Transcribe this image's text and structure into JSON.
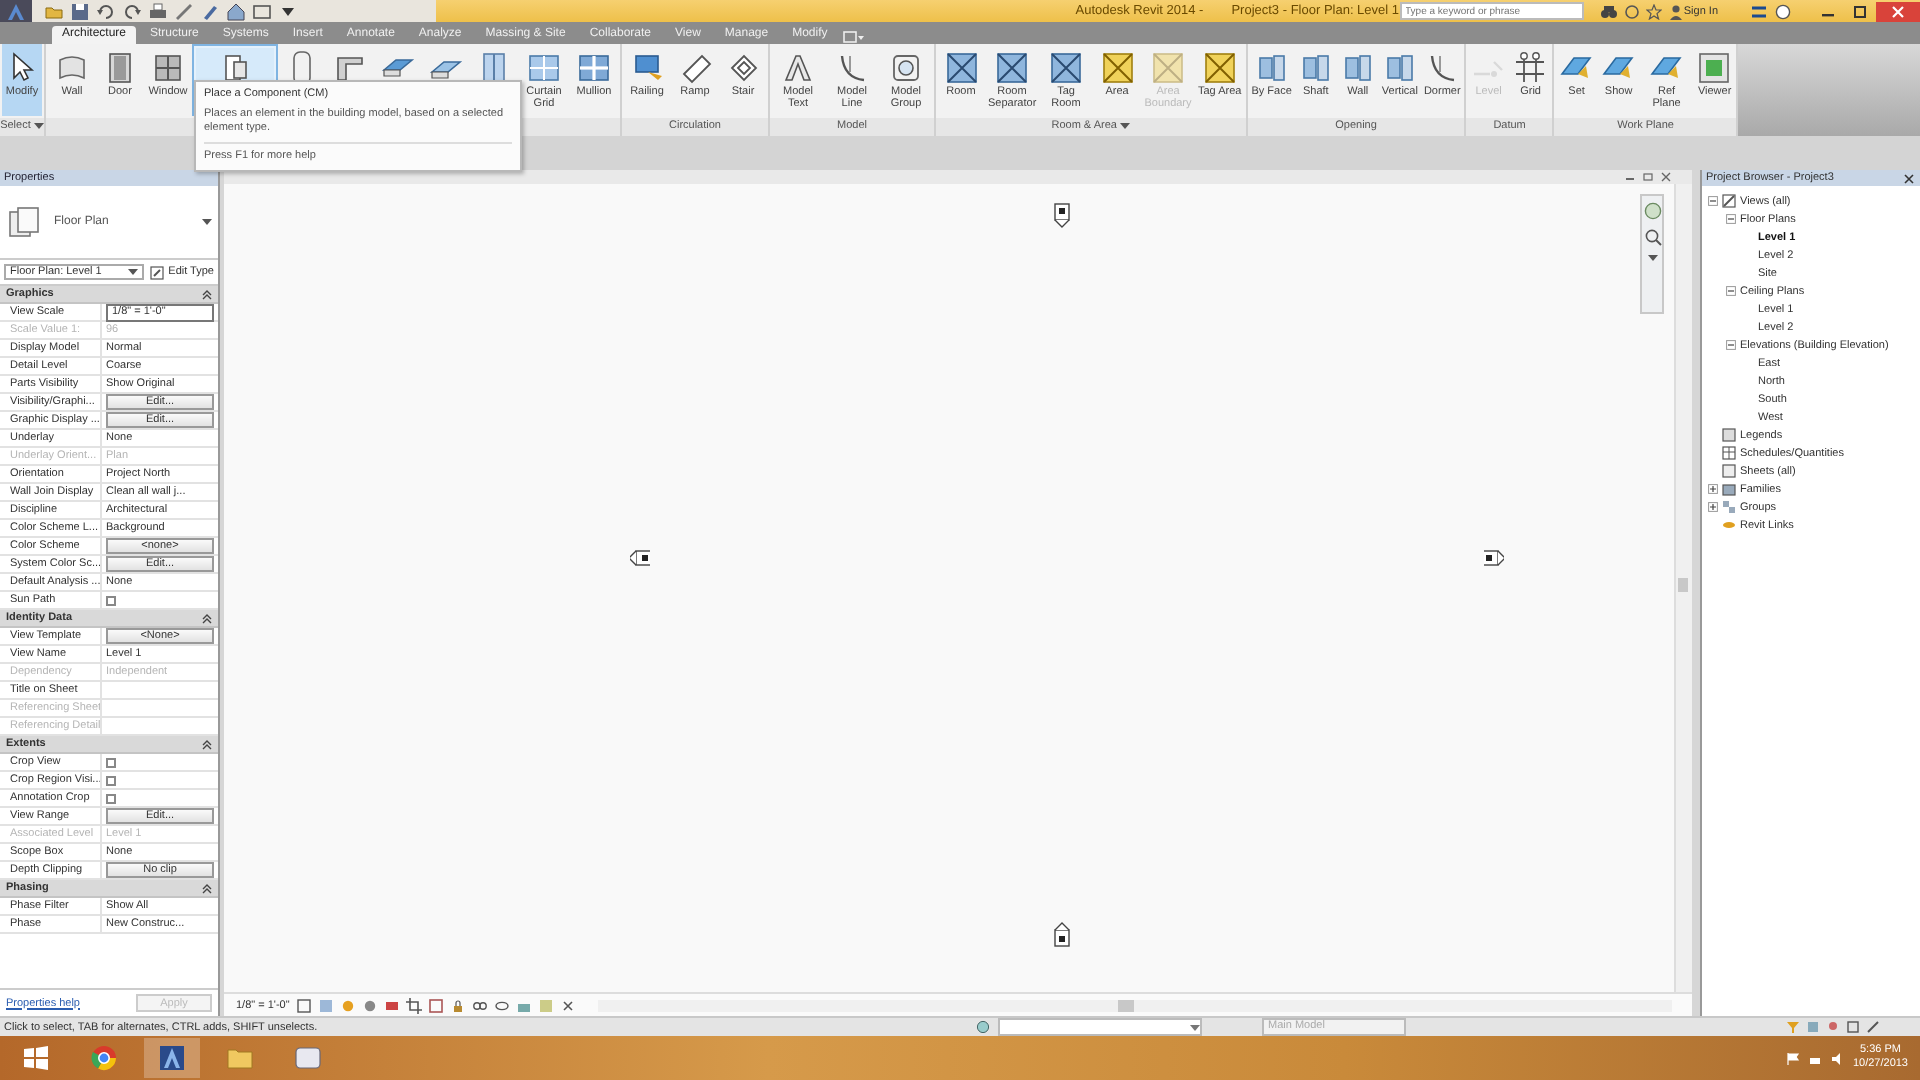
{
  "title_bar": {
    "app_title": "Autodesk Revit 2014 -",
    "document_title": "Project3 - Floor Plan: Level 1",
    "search": {
      "placeholder": "Type a keyword or phrase"
    },
    "sign_in": "Sign In"
  },
  "ribbon_tabs": [
    {
      "label": "Architecture",
      "selected": true
    },
    {
      "label": "Structure",
      "selected": false
    },
    {
      "label": "Systems",
      "selected": false
    },
    {
      "label": "Insert",
      "selected": false
    },
    {
      "label": "Annotate",
      "selected": false
    },
    {
      "label": "Analyze",
      "selected": false
    },
    {
      "label": "Massing & Site",
      "selected": false
    },
    {
      "label": "Collaborate",
      "selected": false
    },
    {
      "label": "View",
      "selected": false
    },
    {
      "label": "Manage",
      "selected": false
    },
    {
      "label": "Modify",
      "selected": false
    }
  ],
  "ribbon_panels": [
    {
      "label": "Select",
      "dropdown": true,
      "buttons": [
        {
          "label": "Modify",
          "active": true,
          "highlighted": false,
          "disabled": false
        }
      ]
    },
    {
      "buttons": [
        {
          "label": "Wall",
          "active": false,
          "highlighted": false,
          "disabled": false
        },
        {
          "label": "Door",
          "active": false,
          "highlighted": false,
          "disabled": false
        },
        {
          "label": "Window",
          "active": false,
          "highlighted": false,
          "disabled": false
        },
        {
          "active": false,
          "highlighted": true,
          "disabled": false
        },
        {
          "active": false,
          "highlighted": false,
          "disabled": false
        },
        {
          "active": false,
          "highlighted": false,
          "disabled": false
        },
        {
          "active": false,
          "highlighted": false,
          "disabled": false
        },
        {
          "active": false,
          "highlighted": false,
          "disabled": false
        },
        {
          "active": false,
          "highlighted": false,
          "disabled": false
        },
        {
          "label": "Curtain Grid",
          "active": false,
          "highlighted": false,
          "disabled": false
        },
        {
          "label": "Mullion",
          "active": false,
          "highlighted": false,
          "disabled": false
        }
      ]
    },
    {
      "label": "Circulation",
      "dropdown": false,
      "buttons": [
        {
          "label": "Railing",
          "active": false,
          "highlighted": false,
          "disabled": false
        },
        {
          "label": "Ramp",
          "active": false,
          "highlighted": false,
          "disabled": false
        },
        {
          "label": "Stair",
          "active": false,
          "highlighted": false,
          "disabled": false
        }
      ]
    },
    {
      "label": "Model",
      "dropdown": false,
      "buttons": [
        {
          "label": "Model Text",
          "active": false,
          "highlighted": false,
          "disabled": false
        },
        {
          "label": "Model Line",
          "active": false,
          "highlighted": false,
          "disabled": false
        },
        {
          "label": "Model Group",
          "active": false,
          "highlighted": false,
          "disabled": false
        }
      ]
    },
    {
      "label": "Room & Area",
      "dropdown": true,
      "buttons": [
        {
          "label": "Room",
          "active": false,
          "highlighted": false,
          "disabled": false
        },
        {
          "label": "Room Separator",
          "active": false,
          "highlighted": false,
          "disabled": false
        },
        {
          "label": "Tag Room",
          "active": false,
          "highlighted": false,
          "disabled": false
        },
        {
          "label": "Area",
          "active": false,
          "highlighted": false,
          "disabled": false
        },
        {
          "label": "Area Boundary",
          "active": false,
          "highlighted": false,
          "disabled": true
        },
        {
          "label": "Tag Area",
          "active": false,
          "highlighted": false,
          "disabled": false
        }
      ]
    },
    {
      "label": "Opening",
      "dropdown": false,
      "buttons": [
        {
          "label": "By Face",
          "active": false,
          "highlighted": false,
          "disabled": false
        },
        {
          "label": "Shaft",
          "active": false,
          "highlighted": false,
          "disabled": false
        },
        {
          "label": "Wall",
          "active": false,
          "highlighted": false,
          "disabled": false
        },
        {
          "label": "Vertical",
          "active": false,
          "highlighted": false,
          "disabled": false
        },
        {
          "label": "Dormer",
          "active": false,
          "highlighted": false,
          "disabled": false
        }
      ]
    },
    {
      "label": "Datum",
      "dropdown": false,
      "buttons": [
        {
          "label": "Level",
          "active": false,
          "highlighted": false,
          "disabled": true
        },
        {
          "label": "Grid",
          "active": false,
          "highlighted": false,
          "disabled": false
        }
      ]
    },
    {
      "label": "Work Plane",
      "dropdown": false,
      "buttons": [
        {
          "label": "Set",
          "active": false,
          "highlighted": false,
          "disabled": false
        },
        {
          "label": "Show",
          "active": false,
          "highlighted": false,
          "disabled": false
        },
        {
          "label": "Ref Plane",
          "active": false,
          "highlighted": false,
          "disabled": false
        },
        {
          "label": "Viewer",
          "active": false,
          "highlighted": false,
          "disabled": false
        }
      ]
    }
  ],
  "tooltip": {
    "title": "Place a Component (CM)",
    "description": "Places an element in the building model, based on a selected element type.",
    "help": "Press F1 for more help"
  },
  "properties": {
    "header": "Properties",
    "type_name": "Floor Plan",
    "instance": "Floor Plan: Level 1",
    "edit_type": "Edit Type",
    "groups": [
      {
        "name": "Graphics",
        "rows": [
          {
            "label": "View Scale",
            "kind": "field",
            "value": "1/8\" = 1'-0\"",
            "disabled": false
          },
          {
            "label": "Scale Value    1:",
            "kind": "text",
            "value": "96",
            "disabled": true
          },
          {
            "label": "Display Model",
            "kind": "text",
            "value": "Normal",
            "disabled": false
          },
          {
            "label": "Detail Level",
            "kind": "text",
            "value": "Coarse",
            "disabled": false
          },
          {
            "label": "Parts Visibility",
            "kind": "text",
            "value": "Show Original",
            "disabled": false
          },
          {
            "label": "Visibility/Graphi...",
            "kind": "button",
            "value": "Edit...",
            "disabled": false
          },
          {
            "label": "Graphic Display ...",
            "kind": "button",
            "value": "Edit...",
            "disabled": false
          },
          {
            "label": "Underlay",
            "kind": "text",
            "value": "None",
            "disabled": false
          },
          {
            "label": "Underlay Orient...",
            "kind": "text",
            "value": "Plan",
            "disabled": true
          },
          {
            "label": "Orientation",
            "kind": "text",
            "value": "Project North",
            "disabled": false
          },
          {
            "label": "Wall Join Display",
            "kind": "text",
            "value": "Clean all wall j...",
            "disabled": false
          },
          {
            "label": "Discipline",
            "kind": "text",
            "value": "Architectural",
            "disabled": false
          },
          {
            "label": "Color Scheme L...",
            "kind": "text",
            "value": "Background",
            "disabled": false
          },
          {
            "label": "Color Scheme",
            "kind": "button",
            "value": "<none>",
            "disabled": false
          },
          {
            "label": "System Color Sc...",
            "kind": "button",
            "value": "Edit...",
            "disabled": false
          },
          {
            "label": "Default Analysis ...",
            "kind": "text",
            "value": "None",
            "disabled": false
          },
          {
            "label": "Sun Path",
            "kind": "checkbox",
            "checked": false,
            "disabled": false
          }
        ]
      },
      {
        "name": "Identity Data",
        "rows": [
          {
            "label": "View Template",
            "kind": "button",
            "value": "<None>",
            "disabled": false
          },
          {
            "label": "View Name",
            "kind": "text",
            "value": "Level 1",
            "disabled": false
          },
          {
            "label": "Dependency",
            "kind": "text",
            "value": "Independent",
            "disabled": true
          },
          {
            "label": "Title on Sheet",
            "kind": "text",
            "disabled": false
          },
          {
            "label": "Referencing Sheet",
            "kind": "text",
            "disabled": true
          },
          {
            "label": "Referencing Detail",
            "kind": "text",
            "disabled": true
          }
        ]
      },
      {
        "name": "Extents",
        "rows": [
          {
            "label": "Crop View",
            "kind": "checkbox",
            "checked": false,
            "disabled": false
          },
          {
            "label": "Crop Region Visi...",
            "kind": "checkbox",
            "checked": false,
            "disabled": false
          },
          {
            "label": "Annotation Crop",
            "kind": "checkbox",
            "checked": false,
            "disabled": false
          },
          {
            "label": "View Range",
            "kind": "button",
            "value": "Edit...",
            "disabled": false
          },
          {
            "label": "Associated Level",
            "kind": "text",
            "value": "Level 1",
            "disabled": true
          },
          {
            "label": "Scope Box",
            "kind": "text",
            "value": "None",
            "disabled": false
          },
          {
            "label": "Depth Clipping",
            "kind": "button",
            "value": "No clip",
            "disabled": false
          }
        ]
      },
      {
        "name": "Phasing",
        "rows": [
          {
            "label": "Phase Filter",
            "kind": "text",
            "value": "Show All",
            "disabled": false
          },
          {
            "label": "Phase",
            "kind": "text",
            "value": "New Construc...",
            "disabled": false
          }
        ]
      }
    ],
    "help_link": "Properties help",
    "apply": {
      "label": "Apply",
      "disabled": true
    }
  },
  "project_browser": {
    "header": "Project Browser - Project3",
    "tree": [
      {
        "label": "Views (all)",
        "expanded": true,
        "current": false,
        "children": [
          {
            "label": "Floor Plans",
            "expanded": true,
            "current": false,
            "children": [
              {
                "label": "Level 1",
                "current": true
              },
              {
                "label": "Level 2",
                "current": false
              },
              {
                "label": "Site",
                "current": false
              }
            ]
          },
          {
            "label": "Ceiling Plans",
            "expanded": true,
            "current": false,
            "children": [
              {
                "label": "Level 1",
                "current": false
              },
              {
                "label": "Level 2",
                "current": false
              }
            ]
          },
          {
            "label": "Elevations (Building Elevation)",
            "expanded": true,
            "current": false,
            "children": [
              {
                "label": "East",
                "current": false
              },
              {
                "label": "North",
                "current": false
              },
              {
                "label": "South",
                "current": false
              },
              {
                "label": "West",
                "current": false
              }
            ]
          }
        ]
      },
      {
        "label": "Legends",
        "current": false
      },
      {
        "label": "Schedules/Quantities",
        "current": false
      },
      {
        "label": "Sheets (all)",
        "current": false
      },
      {
        "label": "Families",
        "expanded": false,
        "current": false
      },
      {
        "label": "Groups",
        "expanded": false,
        "current": false
      },
      {
        "label": "Revit Links",
        "current": false
      }
    ]
  },
  "view_control_bar": {
    "scale": "1/8\" = 1'-0\""
  },
  "status_bar": {
    "message": "Click to select, TAB for alternates, CTRL adds, SHIFT unselects.",
    "model": "Main Model"
  },
  "taskbar": {
    "time": "5:36 PM",
    "date": "10/27/2013"
  }
}
